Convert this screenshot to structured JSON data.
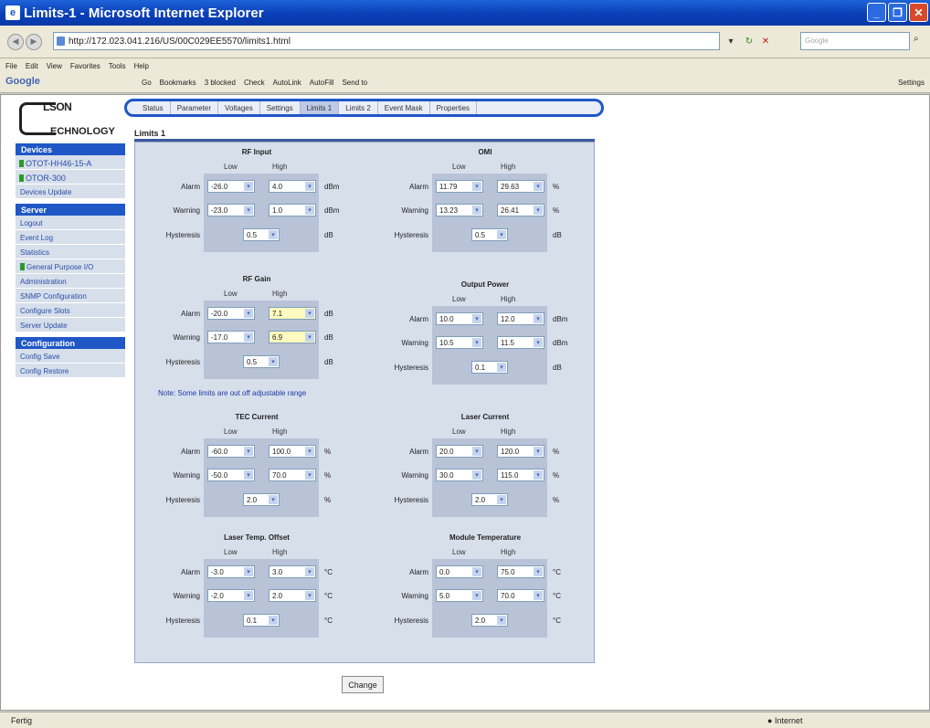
{
  "window": {
    "title": "Limits-1 - Microsoft Internet Explorer",
    "title_icon": "ie-icon"
  },
  "address": {
    "url": "http://172.023.041.216/US/00C029EE5570/limits1.html",
    "search_placeholder": "Google"
  },
  "menu": [
    "File",
    "Edit",
    "View",
    "Favorites",
    "Tools",
    "Help"
  ],
  "google_bar": {
    "logo": "Google",
    "items": [
      "Go",
      "Bookmarks",
      "3 blocked",
      "Check",
      "AutoLink",
      "AutoFill",
      "Send to"
    ],
    "settings": "Settings"
  },
  "logo": {
    "line1": "LSON",
    "line2": "ECHNOLOGY"
  },
  "tabs": [
    "Status",
    "Parameter",
    "Voltages",
    "Settings",
    "Limits 1",
    "Limits 2",
    "Event Mask",
    "Properties"
  ],
  "active_tab": "Limits 1",
  "page_title": "Limits 1",
  "sidebar": {
    "devices_title": "Devices",
    "devices": [
      "OTOT-HH46-15-A",
      "OTOR-300"
    ],
    "devices_update": "Devices Update",
    "server_title": "Server",
    "server_items": [
      "Logout",
      "Event Log",
      "Statistics",
      "General Purpose I/O",
      "Administration",
      "SNMP Configuration",
      "Configure Slots",
      "Server Update"
    ],
    "config_title": "Configuration",
    "config_items": [
      "Config Save",
      "Config Restore"
    ]
  },
  "labels": {
    "low": "Low",
    "high": "High",
    "alarm": "Alarm",
    "warning": "Warning",
    "hysteresis": "Hysteresis"
  },
  "sections": {
    "rf_input": {
      "title": "RF Input",
      "alarm_low": "-26.0",
      "alarm_high": "4.0",
      "warning_low": "-23.0",
      "warning_high": "1.0",
      "hyst": "0.5",
      "unit": "dBm",
      "hunit": "dB"
    },
    "omi": {
      "title": "OMI",
      "alarm_low": "11.79",
      "alarm_high": "29.63",
      "warning_low": "13.23",
      "warning_high": "26.41",
      "hyst": "0.5",
      "unit": "%",
      "hunit": "dB"
    },
    "rf_gain": {
      "title": "RF Gain",
      "alarm_low": "-20.0",
      "alarm_high": "7.1",
      "warning_low": "-17.0",
      "warning_high": "6.9",
      "hyst": "0.5",
      "unit": "dB",
      "hunit": "dB"
    },
    "output_power": {
      "title": "Output Power",
      "alarm_low": "10.0",
      "alarm_high": "12.0",
      "warning_low": "10.5",
      "warning_high": "11.5",
      "hyst": "0.1",
      "unit": "dBm",
      "hunit": "dB"
    },
    "tec_current": {
      "title": "TEC Current",
      "alarm_low": "-60.0",
      "alarm_high": "100.0",
      "warning_low": "-50.0",
      "warning_high": "70.0",
      "hyst": "2.0",
      "unit": "%",
      "hunit": "%"
    },
    "laser_current": {
      "title": "Laser Current",
      "alarm_low": "20.0",
      "alarm_high": "120.0",
      "warning_low": "30.0",
      "warning_high": "115.0",
      "hyst": "2.0",
      "unit": "%",
      "hunit": "%"
    },
    "laser_temp": {
      "title": "Laser Temp. Offset",
      "alarm_low": "-3.0",
      "alarm_high": "3.0",
      "warning_low": "-2.0",
      "warning_high": "2.0",
      "hyst": "0.1",
      "unit": "°C",
      "hunit": "°C"
    },
    "module_temp": {
      "title": "Module Temperature",
      "alarm_low": "0.0",
      "alarm_high": "75.0",
      "warning_low": "5.0",
      "warning_high": "70.0",
      "hyst": "2.0",
      "unit": "°C",
      "hunit": "°C"
    }
  },
  "note": "Note: Some limits are out off adjustable range",
  "change_button": "Change",
  "status": {
    "text": "Fertig",
    "zone": "Internet"
  }
}
